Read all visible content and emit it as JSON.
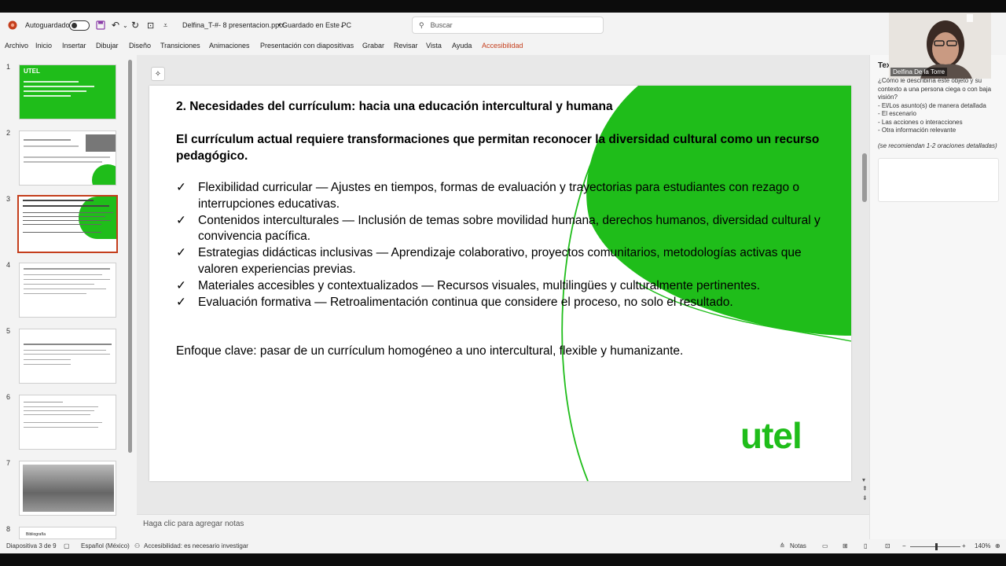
{
  "titlebar": {
    "autosave_label": "Autoguardado",
    "doc_title": "Delfina_T-#- 8 presentacion.pptx",
    "save_status": "Guardado en Este PC",
    "search_placeholder": "Buscar"
  },
  "menu": [
    "Archivo",
    "Inicio",
    "Insertar",
    "Dibujar",
    "Diseño",
    "Transiciones",
    "Animaciones",
    "Presentación con diapositivas",
    "Grabar",
    "Revisar",
    "Vista",
    "Ayuda",
    "Accesibilidad"
  ],
  "thumbnails": {
    "numbers": [
      "1",
      "2",
      "3",
      "4",
      "5",
      "6",
      "7",
      "8"
    ],
    "thumb1_brand": "UTEL",
    "thumb8_text": "Bibliografía"
  },
  "slide": {
    "title": "2. Necesidades del currículum: hacia una educación intercultural y humana",
    "subtitle": "El currículum actual requiere transformaciones que permitan reconocer la diversidad cultural como un recurso pedagógico.",
    "bullets": [
      "Flexibilidad curricular — Ajustes en tiempos, formas de evaluación y trayectorias para estudiantes con rezago o interrupciones educativas.",
      "Contenidos interculturales — Inclusión de temas sobre movilidad humana, derechos humanos, diversidad cultural y convivencia pacífica.",
      "Estrategias didácticas inclusivas — Aprendizaje colaborativo, proyectos comunitarios, metodologías activas que valoren experiencias previas.",
      "Materiales accesibles y contextualizados — Recursos visuales, multilingües y culturalmente pertinentes.",
      "Evaluación formativa — Retroalimentación continua que considere el proceso, no solo el resultado."
    ],
    "check_mark": "✓",
    "key_point": "Enfoque clave: pasar de un currículum homogéneo a uno intercultural, flexible y humanizante.",
    "logo": "utel"
  },
  "notes_placeholder": "Haga clic para agregar notas",
  "right_pane": {
    "heading_partial": "Tex",
    "help_lines": [
      "¿Cómo le describiría este objeto y su contexto a una persona ciega o con baja visión?",
      "- El/Los asunto(s) de manera detallada",
      "- El escenario",
      "- Las acciones o interacciones",
      "- Otra información relevante"
    ],
    "recommendation": "(se recomiendan 1-2 oraciones detalladas)"
  },
  "video": {
    "participant": "Delfina De la Torre"
  },
  "statusbar": {
    "slide_counter": "Diapositiva 3 de 9",
    "language": "Español (México)",
    "accessibility": "Accesibilidad: es necesario investigar",
    "notes_label": "Notas",
    "zoom": "140%"
  },
  "colors": {
    "brand_green": "#1fbd1a",
    "accent_red": "#c43e1c",
    "accessibility_tab": "#c43e1c"
  }
}
